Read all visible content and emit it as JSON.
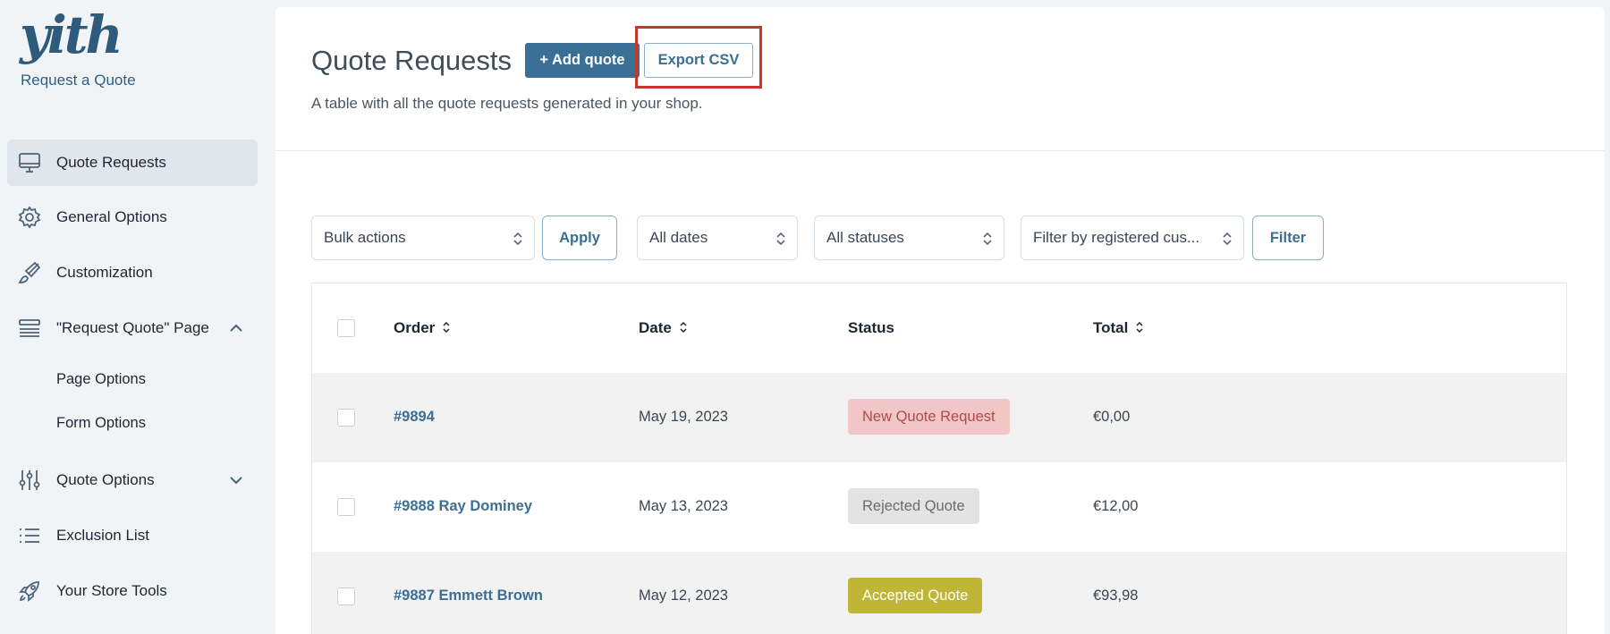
{
  "sidebar": {
    "logo_text": "yith",
    "plugin_name": "Request a Quote",
    "items": [
      {
        "label": "Quote Requests",
        "icon": "monitor-icon"
      },
      {
        "label": "General Options",
        "icon": "gear-icon"
      },
      {
        "label": "Customization",
        "icon": "brush-icon"
      },
      {
        "label": "\"Request Quote\" Page",
        "icon": "layers-icon"
      },
      {
        "label": "Quote Options",
        "icon": "sliders-icon"
      },
      {
        "label": "Exclusion List",
        "icon": "list-icon"
      },
      {
        "label": "Your Store Tools",
        "icon": "rocket-icon"
      }
    ],
    "sub_items": [
      "Page Options",
      "Form Options"
    ]
  },
  "header": {
    "title": "Quote Requests",
    "add_button": "+ Add quote",
    "export_button": "Export CSV",
    "description": "A table with all the quote requests generated in your shop."
  },
  "filters": {
    "bulk_actions": "Bulk actions",
    "apply": "Apply",
    "dates": "All dates",
    "statuses": "All statuses",
    "customer": "Filter by registered cus...",
    "filter": "Filter"
  },
  "table": {
    "columns": [
      "Order",
      "Date",
      "Status",
      "Total"
    ],
    "rows": [
      {
        "order": "#9894",
        "date": "May 19, 2023",
        "status": "New Quote Request",
        "total": "€0,00"
      },
      {
        "order": "#9888 Ray Dominey",
        "date": "May 13, 2023",
        "status": "Rejected Quote",
        "total": "€12,00"
      },
      {
        "order": "#9887 Emmett Brown",
        "date": "May 12, 2023",
        "status": "Accepted Quote",
        "total": "€93,98"
      }
    ]
  },
  "colors": {
    "primary": "#3b7096",
    "highlight": "#c0392b",
    "status_new_bg": "#f1c6c6",
    "status_new_text": "#b24a4a",
    "status_rejected_bg": "#e3e3e3",
    "status_rejected_text": "#6b6b6b",
    "status_accepted_bg": "#bfb537",
    "status_accepted_text": "#ffffff"
  }
}
